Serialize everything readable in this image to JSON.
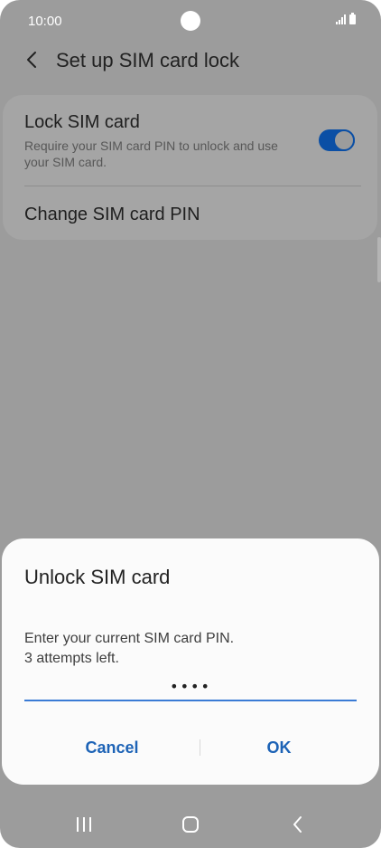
{
  "status_bar": {
    "time": "10:00"
  },
  "header": {
    "title": "Set up SIM card lock"
  },
  "settings": {
    "lock_sim": {
      "title": "Lock SIM card",
      "description": "Require your SIM card PIN to unlock and use your SIM card.",
      "enabled": true
    },
    "change_pin": {
      "label": "Change SIM card PIN"
    }
  },
  "dialog": {
    "title": "Unlock SIM card",
    "message_line1": "Enter your current SIM card PIN.",
    "message_line2": "3 attempts left.",
    "pin_value": "••••",
    "cancel_label": "Cancel",
    "ok_label": "OK"
  },
  "colors": {
    "accent": "#1d63b6",
    "toggle": "#0b4fa5",
    "input_underline": "#3a7bd5",
    "dim_overlay": "#9c9c9c"
  },
  "icons": {
    "back": "back-arrow-icon",
    "signal": "signal-icon",
    "battery": "battery-icon",
    "recents": "recents-icon",
    "home": "home-icon",
    "nav_back": "nav-back-icon"
  }
}
